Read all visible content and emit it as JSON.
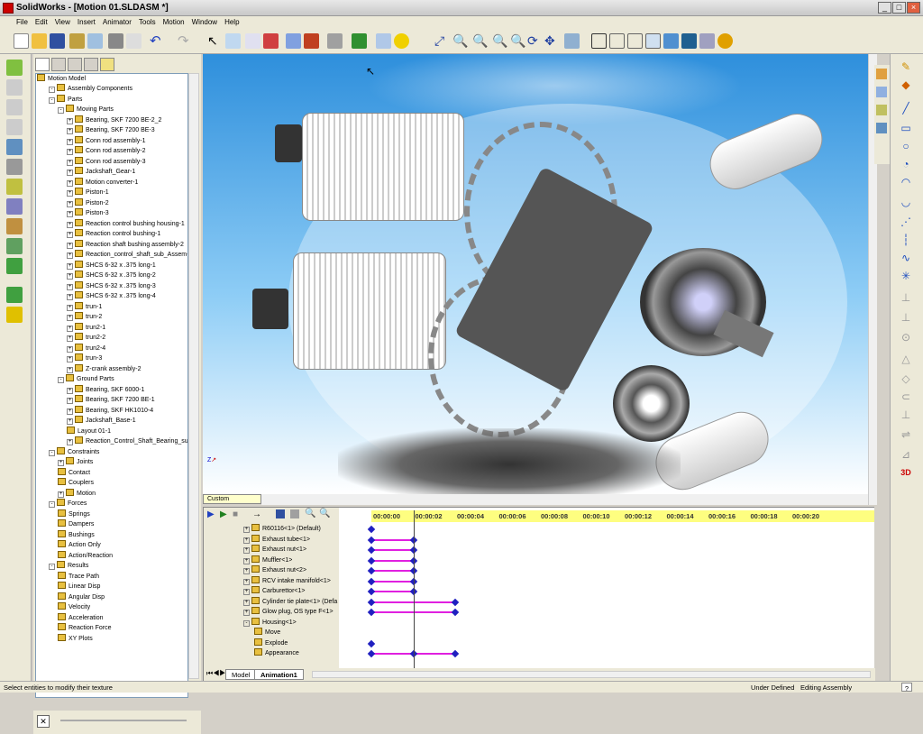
{
  "window": {
    "app_name": "SolidWorks",
    "title": "SolidWorks - [Motion 01.SLDASM *]"
  },
  "menu": [
    "File",
    "Edit",
    "View",
    "Insert",
    "Animator",
    "Tools",
    "Motion",
    "Window",
    "Help"
  ],
  "tree": {
    "root": "Motion Model",
    "items": [
      {
        "label": "Assembly Components",
        "d": 1,
        "e": "-"
      },
      {
        "label": "Parts",
        "d": 1,
        "e": "-"
      },
      {
        "label": "Moving Parts",
        "d": 2,
        "e": "-"
      },
      {
        "label": "Bearing, SKF 7200 BE-2_2",
        "d": 3,
        "e": "+"
      },
      {
        "label": "Bearing, SKF 7200 BE-3",
        "d": 3,
        "e": "+"
      },
      {
        "label": "Conn rod assembly-1",
        "d": 3,
        "e": "+"
      },
      {
        "label": "Conn rod assembly-2",
        "d": 3,
        "e": "+"
      },
      {
        "label": "Conn rod assembly-3",
        "d": 3,
        "e": "+"
      },
      {
        "label": "Jackshaft_Gear-1",
        "d": 3,
        "e": "+"
      },
      {
        "label": "Motion converter-1",
        "d": 3,
        "e": "+"
      },
      {
        "label": "Piston-1",
        "d": 3,
        "e": "+"
      },
      {
        "label": "Piston-2",
        "d": 3,
        "e": "+"
      },
      {
        "label": "Piston-3",
        "d": 3,
        "e": "+"
      },
      {
        "label": "Reaction control bushing housing-1",
        "d": 3,
        "e": "+"
      },
      {
        "label": "Reaction control bushing-1",
        "d": 3,
        "e": "+"
      },
      {
        "label": "Reaction shaft bushing assembly-2",
        "d": 3,
        "e": "+"
      },
      {
        "label": "Reaction_control_shaft_sub_Assem-2",
        "d": 3,
        "e": "+"
      },
      {
        "label": "SHCS 6-32 x .375 long-1",
        "d": 3,
        "e": "+"
      },
      {
        "label": "SHCS 6-32 x .375 long-2",
        "d": 3,
        "e": "+"
      },
      {
        "label": "SHCS 6-32 x .375 long-3",
        "d": 3,
        "e": "+"
      },
      {
        "label": "SHCS 6-32 x .375 long-4",
        "d": 3,
        "e": "+"
      },
      {
        "label": "trun-1",
        "d": 3,
        "e": "+"
      },
      {
        "label": "trun-2",
        "d": 3,
        "e": "+"
      },
      {
        "label": "trun2-1",
        "d": 3,
        "e": "+"
      },
      {
        "label": "trun2-2",
        "d": 3,
        "e": "+"
      },
      {
        "label": "trun2-4",
        "d": 3,
        "e": "+"
      },
      {
        "label": "trun-3",
        "d": 3,
        "e": "+"
      },
      {
        "label": "Z-crank assembly-2",
        "d": 3,
        "e": "+"
      },
      {
        "label": "Ground Parts",
        "d": 2,
        "e": "-"
      },
      {
        "label": "Bearing, SKF 6000-1",
        "d": 3,
        "e": "+"
      },
      {
        "label": "Bearing, SKF 7200 BE-1",
        "d": 3,
        "e": "+"
      },
      {
        "label": "Bearing, SKF HK1010-4",
        "d": 3,
        "e": "+"
      },
      {
        "label": "Jackshaft_Base-1",
        "d": 3,
        "e": "+"
      },
      {
        "label": "Layout 01-1",
        "d": 3,
        "e": ""
      },
      {
        "label": "Reaction_Control_Shaft_Bearing_sub",
        "d": 3,
        "e": "+"
      },
      {
        "label": "Constraints",
        "d": 1,
        "e": "-"
      },
      {
        "label": "Joints",
        "d": 2,
        "e": "+"
      },
      {
        "label": "Contact",
        "d": 2,
        "e": ""
      },
      {
        "label": "Couplers",
        "d": 2,
        "e": ""
      },
      {
        "label": "Motion",
        "d": 2,
        "e": "+"
      },
      {
        "label": "Forces",
        "d": 1,
        "e": "-"
      },
      {
        "label": "Springs",
        "d": 2,
        "e": ""
      },
      {
        "label": "Dampers",
        "d": 2,
        "e": ""
      },
      {
        "label": "Bushings",
        "d": 2,
        "e": ""
      },
      {
        "label": "Action Only",
        "d": 2,
        "e": ""
      },
      {
        "label": "Action/Reaction",
        "d": 2,
        "e": ""
      },
      {
        "label": "Results",
        "d": 1,
        "e": "-"
      },
      {
        "label": "Trace Path",
        "d": 2,
        "e": ""
      },
      {
        "label": "Linear Disp",
        "d": 2,
        "e": ""
      },
      {
        "label": "Angular Disp",
        "d": 2,
        "e": ""
      },
      {
        "label": "Velocity",
        "d": 2,
        "e": ""
      },
      {
        "label": "Acceleration",
        "d": 2,
        "e": ""
      },
      {
        "label": "Reaction Force",
        "d": 2,
        "e": ""
      },
      {
        "label": "XY Plots",
        "d": 2,
        "e": ""
      }
    ]
  },
  "viewport": {
    "display_state": "Custom",
    "triad": "Z"
  },
  "animator": {
    "items": [
      {
        "label": "R60116<1> (Default)",
        "d": 1,
        "e": "+"
      },
      {
        "label": "Exhaust tube<1>",
        "d": 1,
        "e": "+"
      },
      {
        "label": "Exhaust nut<1>",
        "d": 1,
        "e": "+"
      },
      {
        "label": "Muffler<1>",
        "d": 1,
        "e": "+"
      },
      {
        "label": "Exhaust nut<2>",
        "d": 1,
        "e": "+"
      },
      {
        "label": "RCV intake manifold<1>",
        "d": 1,
        "e": "+"
      },
      {
        "label": "Carburettor<1>",
        "d": 1,
        "e": "+"
      },
      {
        "label": "Cylinder tie plate<1> (Defa",
        "d": 1,
        "e": "+"
      },
      {
        "label": "Glow plug, OS type F<1>",
        "d": 1,
        "e": "+"
      },
      {
        "label": "Housing<1>",
        "d": 1,
        "e": "-"
      },
      {
        "label": "Move",
        "d": 2,
        "e": ""
      },
      {
        "label": "Explode",
        "d": 2,
        "e": ""
      },
      {
        "label": "Appearance",
        "d": 2,
        "e": ""
      }
    ],
    "ticks": [
      "00:00:00",
      "00:00:02",
      "00:00:04",
      "00:00:06",
      "00:00:08",
      "00:00:10",
      "00:00:12",
      "00:00:14",
      "00:00:16",
      "00:00:18",
      "00:00:20"
    ],
    "current_time_s": 2,
    "tracks": [
      {
        "row": 0,
        "keys": [
          0
        ]
      },
      {
        "row": 1,
        "keys": [
          0,
          2
        ],
        "bar": [
          0,
          2
        ]
      },
      {
        "row": 2,
        "keys": [
          0,
          2
        ],
        "bar": [
          0,
          2
        ]
      },
      {
        "row": 3,
        "keys": [
          0,
          2
        ],
        "bar": [
          0,
          2
        ]
      },
      {
        "row": 4,
        "keys": [
          0,
          2
        ],
        "bar": [
          0,
          2
        ]
      },
      {
        "row": 5,
        "keys": [
          0,
          2
        ],
        "bar": [
          0,
          2
        ]
      },
      {
        "row": 6,
        "keys": [
          0,
          2
        ],
        "bar": [
          0,
          2
        ]
      },
      {
        "row": 7,
        "keys": [
          0,
          4
        ],
        "bar": [
          0,
          4
        ]
      },
      {
        "row": 8,
        "keys": [
          0,
          4
        ],
        "bar": [
          0,
          4
        ]
      },
      {
        "row": 11,
        "keys": [
          0
        ]
      },
      {
        "row": 12,
        "keys": [
          0,
          2,
          4
        ],
        "bar": [
          0,
          4
        ]
      }
    ],
    "tabs": [
      "Model",
      "Animation1"
    ]
  },
  "status": {
    "hint": "Select entities to modify their texture",
    "state": "Under Defined",
    "mode": "Editing Assembly",
    "help": "?"
  }
}
